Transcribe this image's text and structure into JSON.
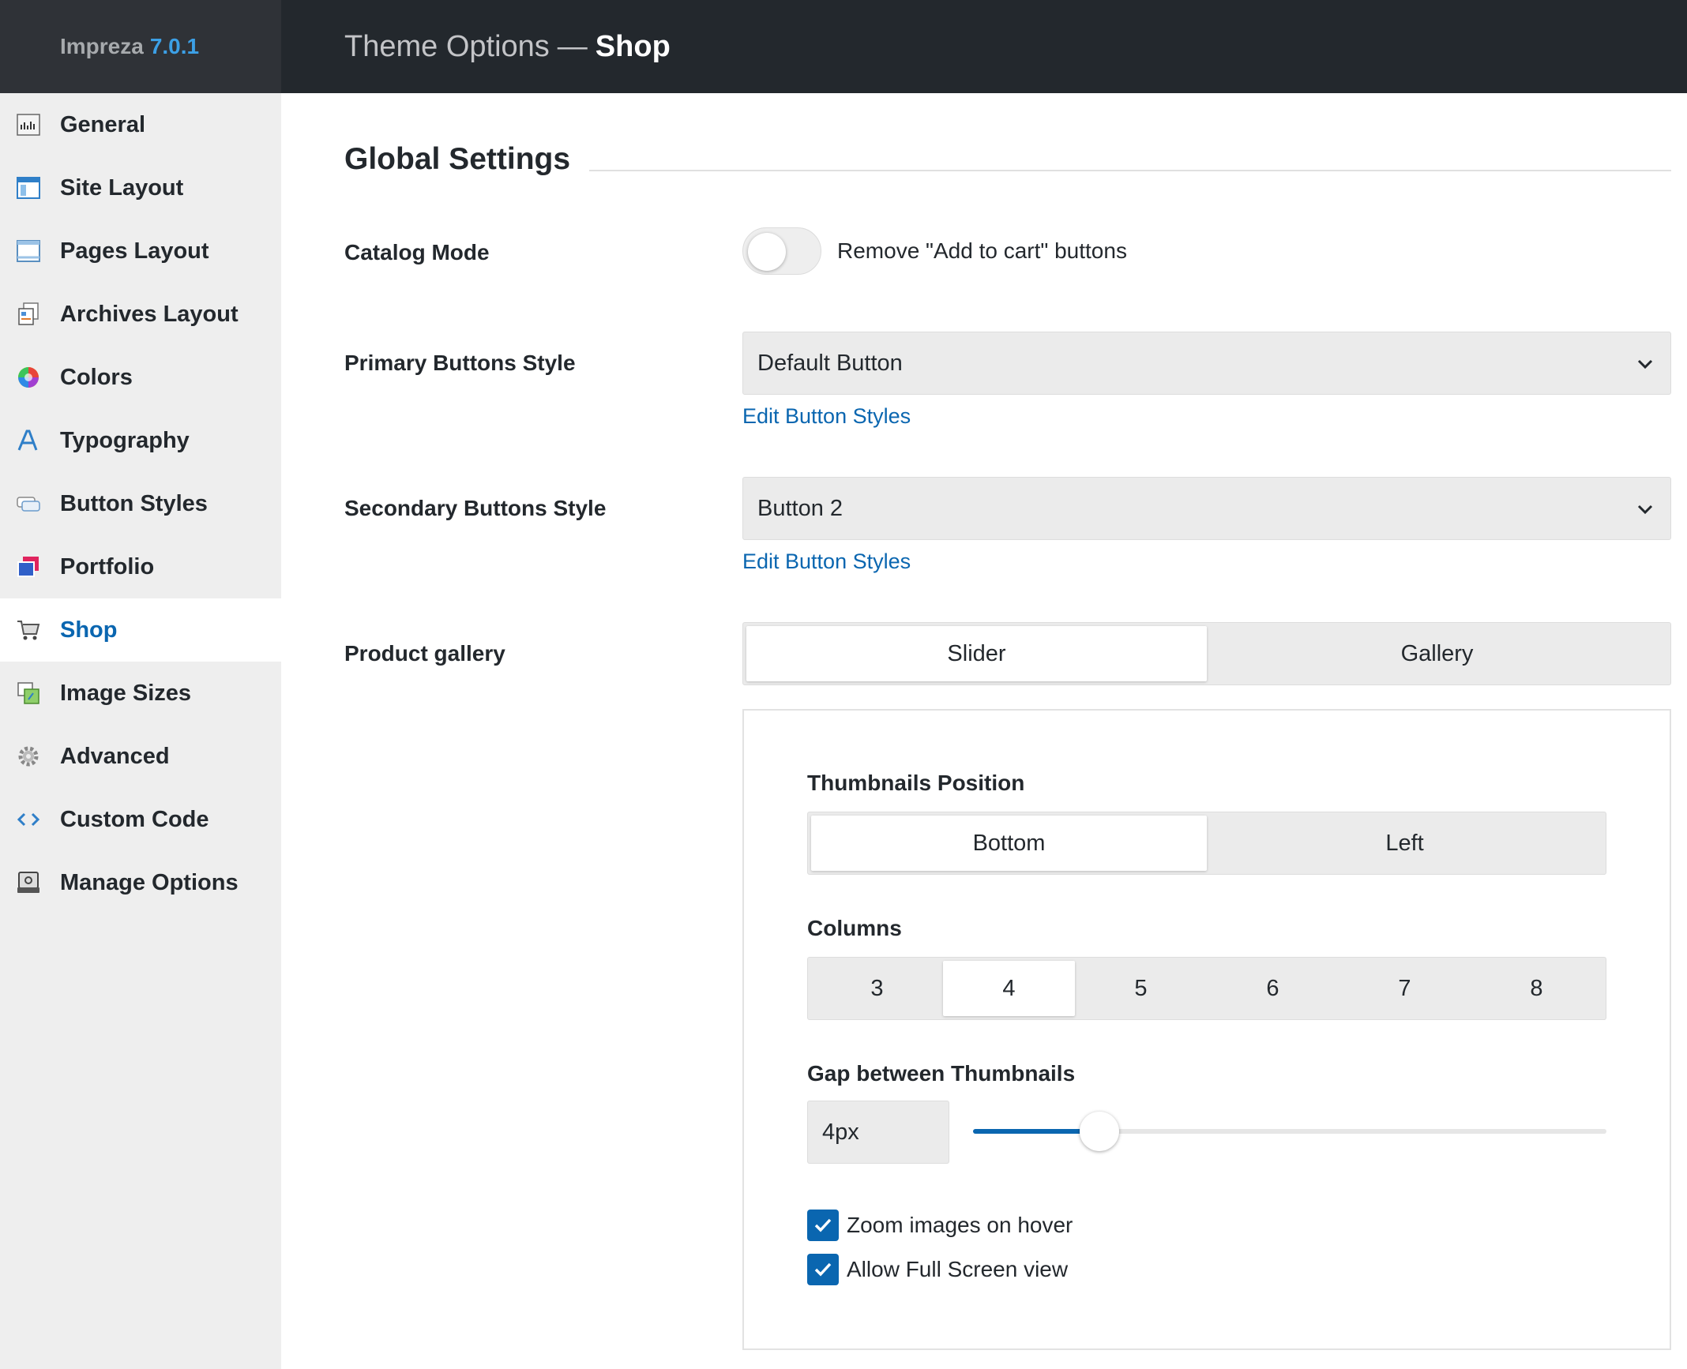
{
  "sidebar": {
    "brand": "Impreza",
    "version": "7.0.1",
    "items": [
      {
        "label": "General",
        "icon": "general-icon"
      },
      {
        "label": "Site Layout",
        "icon": "site-layout-icon"
      },
      {
        "label": "Pages Layout",
        "icon": "pages-layout-icon"
      },
      {
        "label": "Archives Layout",
        "icon": "archives-layout-icon"
      },
      {
        "label": "Colors",
        "icon": "colors-icon"
      },
      {
        "label": "Typography",
        "icon": "typography-icon"
      },
      {
        "label": "Button Styles",
        "icon": "button-styles-icon"
      },
      {
        "label": "Portfolio",
        "icon": "portfolio-icon"
      },
      {
        "label": "Shop",
        "icon": "cart-icon",
        "active": true
      },
      {
        "label": "Image Sizes",
        "icon": "image-sizes-icon"
      },
      {
        "label": "Advanced",
        "icon": "gear-icon"
      },
      {
        "label": "Custom Code",
        "icon": "code-icon"
      },
      {
        "label": "Manage Options",
        "icon": "manage-options-icon"
      }
    ]
  },
  "header": {
    "prefix": "Theme Options",
    "separator": "—",
    "page": "Shop"
  },
  "main": {
    "section_title": "Global Settings",
    "catalog_mode": {
      "label": "Catalog Mode",
      "toggle_text": "Remove \"Add to cart\" buttons",
      "enabled": false
    },
    "primary_buttons": {
      "label": "Primary Buttons Style",
      "value": "Default Button",
      "link": "Edit Button Styles"
    },
    "secondary_buttons": {
      "label": "Secondary Buttons Style",
      "value": "Button 2",
      "link": "Edit Button Styles"
    },
    "product_gallery": {
      "label": "Product gallery",
      "options": [
        "Slider",
        "Gallery"
      ],
      "selected": "Slider"
    },
    "thumbnails_position": {
      "label": "Thumbnails Position",
      "options": [
        "Bottom",
        "Left"
      ],
      "selected": "Bottom"
    },
    "columns": {
      "label": "Columns",
      "options": [
        "3",
        "4",
        "5",
        "6",
        "7",
        "8"
      ],
      "selected": "4"
    },
    "gap": {
      "label": "Gap between Thumbnails",
      "value": "4px",
      "slider_fraction": 0.2
    },
    "checkboxes": [
      {
        "label": "Zoom images on hover",
        "checked": true
      },
      {
        "label": "Allow Full Screen view",
        "checked": true
      }
    ]
  },
  "colors": {
    "accent": "#0a66b0",
    "header_bg": "#23282d",
    "brand_bg": "#2f3237",
    "version": "#3ca0e6",
    "sidebar_bg": "#eeeeee"
  }
}
